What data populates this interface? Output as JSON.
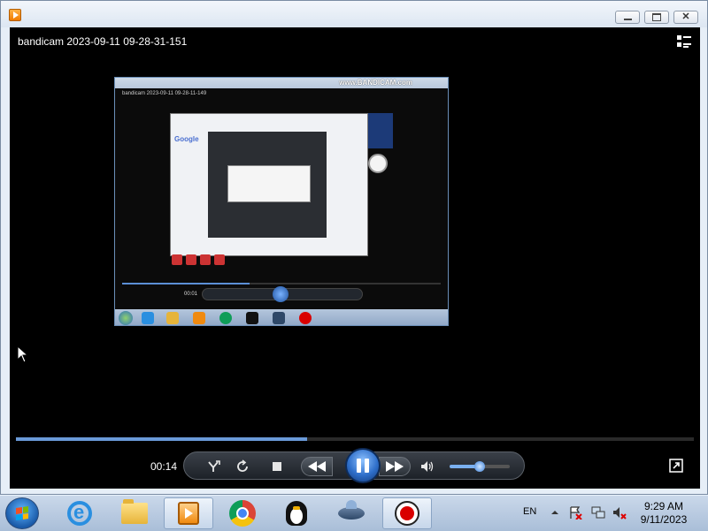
{
  "window": {
    "title_icon": "bandicam-player-icon"
  },
  "player": {
    "video_title": "bandicam 2023-09-11 09-28-31-151",
    "elapsed_time": "00:14",
    "seek_progress_pct": 43,
    "volume_pct": 50,
    "embedded_frame": {
      "watermark": "www.BANDICAM.com",
      "inner_title": "bandicam 2023-09-11 09-28-11-149",
      "time": "00:01"
    }
  },
  "taskbar": {
    "items": [
      "internet-explorer",
      "file-explorer",
      "bandicam-player",
      "chrome",
      "tux",
      "ufo",
      "bandicam-record"
    ],
    "language": "EN",
    "clock_time": "9:29 AM",
    "clock_date": "9/11/2023"
  },
  "colors": {
    "accent": "#2f6fca",
    "record": "#d90000",
    "player_bg": "#000000"
  }
}
